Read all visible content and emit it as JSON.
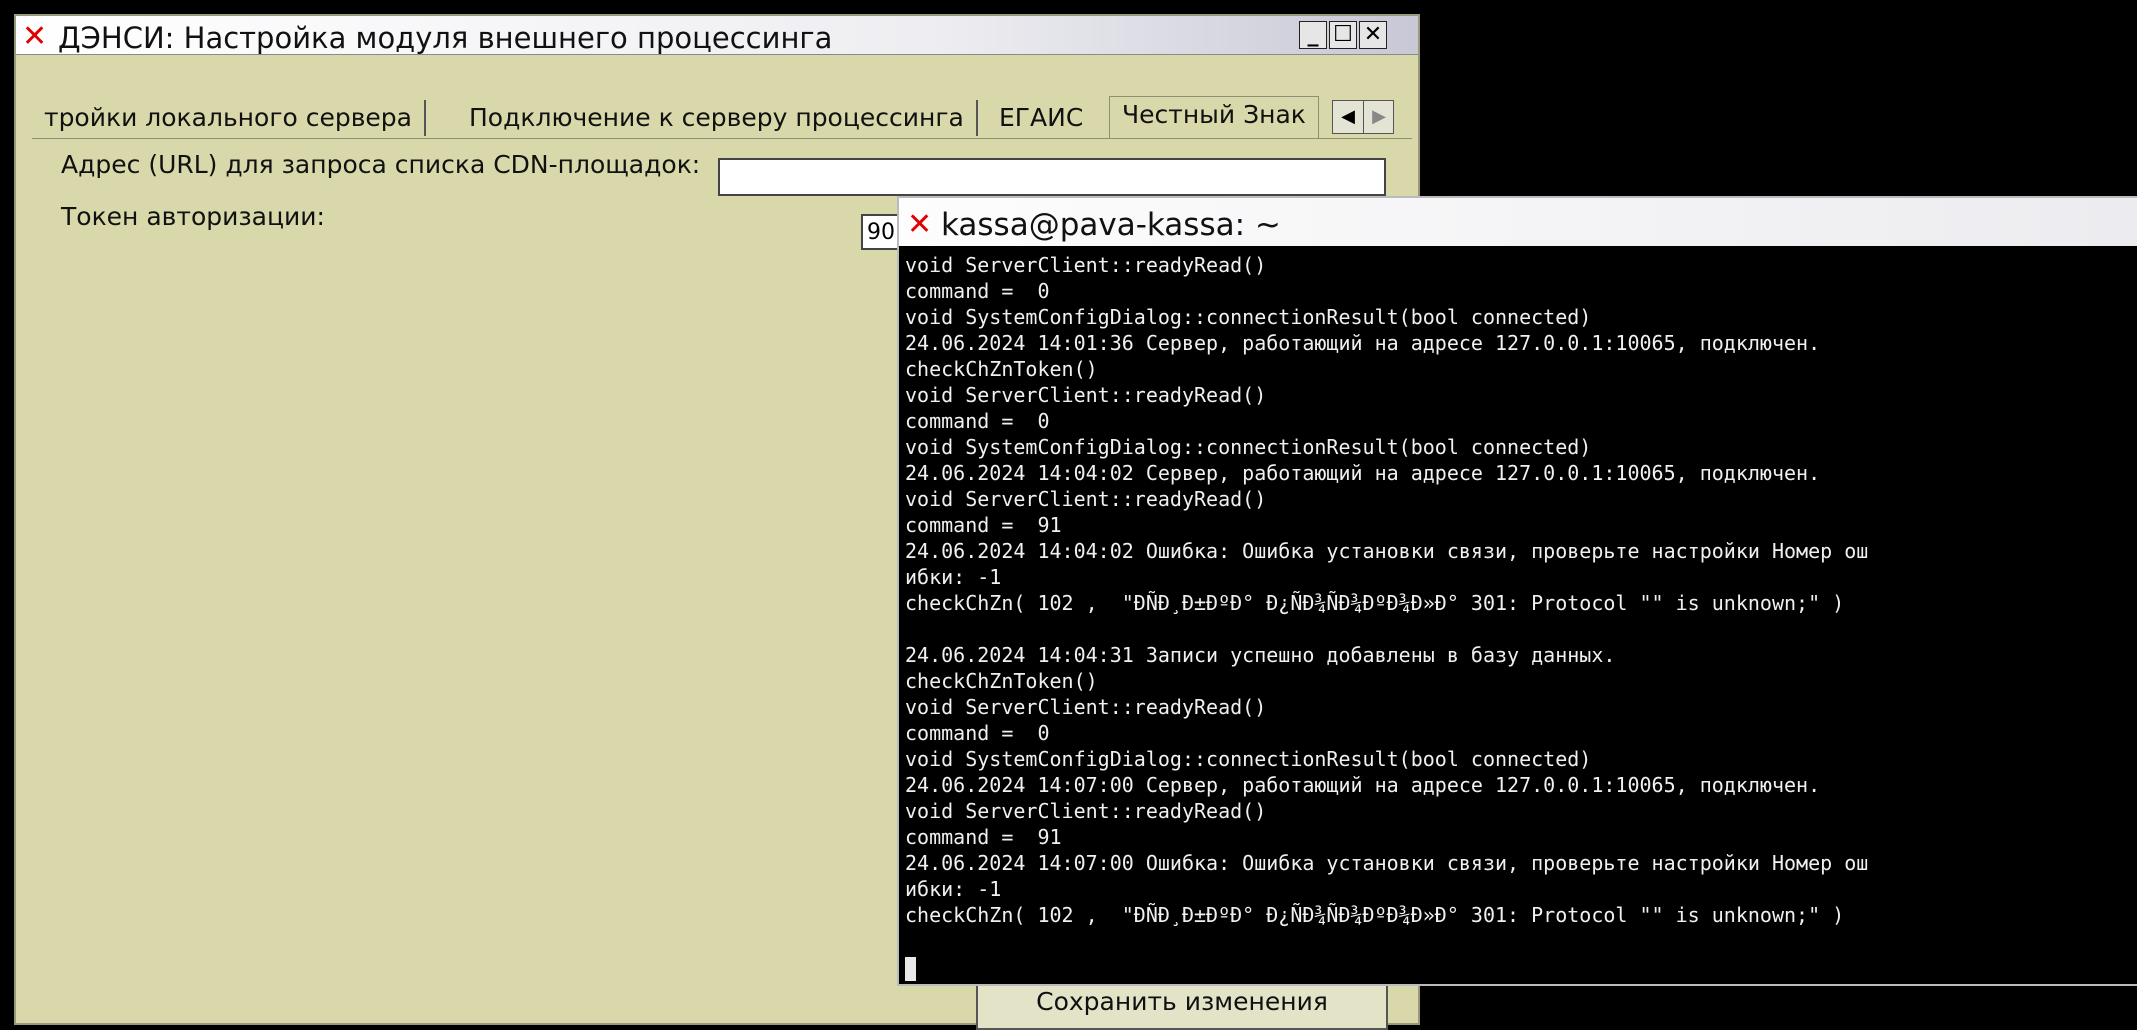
{
  "dialog": {
    "title": "ДЭНСИ: Настройка модуля внешнего процессинга",
    "tabs": [
      {
        "label": "тройки локального сервера"
      },
      {
        "label": "Подключение к серверу процессинга"
      },
      {
        "label": "ЕГАИС"
      },
      {
        "label": "Честный Знак"
      }
    ],
    "url_label": "Адрес (URL) для запроса списка CDN-площадок:",
    "url_value": "",
    "token_label": "Токен авторизации:",
    "token_value": "90",
    "save_button": "Сохранить изменения"
  },
  "terminal": {
    "title": "kassa@pava-kassa: ~",
    "lines": [
      "void ServerClient::readyRead()",
      "command =  0",
      "void SystemConfigDialog::connectionResult(bool connected)",
      "24.06.2024 14:01:36 Сервер, работающий на адресе 127.0.0.1:10065, подключен.",
      "checkChZnToken()",
      "void ServerClient::readyRead()",
      "command =  0",
      "void SystemConfigDialog::connectionResult(bool connected)",
      "24.06.2024 14:04:02 Сервер, работающий на адресе 127.0.0.1:10065, подключен.",
      "void ServerClient::readyRead()",
      "command =  91",
      "24.06.2024 14:04:02 Ошибка: Ошибка установки связи, проверьте настройки Номер ош",
      "ибки: -1",
      "checkChZn( 102 ,  \"ÐÑÐ¸Ð±ÐºÐ° Ð¿ÑÐ¾ÑÐ¾ÐºÐ¾Ð»Ð° 301: Protocol \"\" is unknown;\" )",
      "",
      "24.06.2024 14:04:31 Записи успешно добавлены в базу данных.",
      "checkChZnToken()",
      "void ServerClient::readyRead()",
      "command =  0",
      "void SystemConfigDialog::connectionResult(bool connected)",
      "24.06.2024 14:07:00 Сервер, работающий на адресе 127.0.0.1:10065, подключен.",
      "void ServerClient::readyRead()",
      "command =  91",
      "24.06.2024 14:07:00 Ошибка: Ошибка установки связи, проверьте настройки Номер ош",
      "ибки: -1",
      "checkChZn( 102 ,  \"ÐÑÐ¸Ð±ÐºÐ° Ð¿ÑÐ¾ÑÐ¾ÐºÐ¾Ð»Ð° 301: Protocol \"\" is unknown;\" )",
      ""
    ]
  }
}
